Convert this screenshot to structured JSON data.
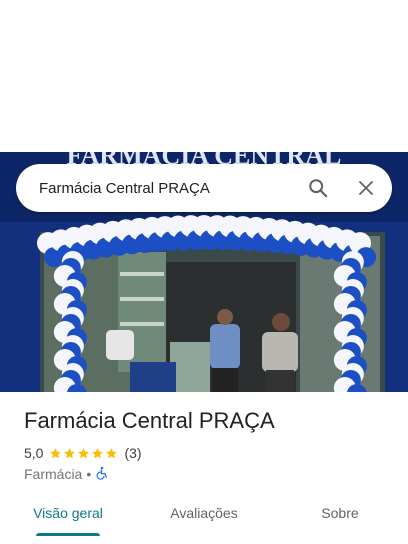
{
  "search": {
    "query": "Farmácia Central PRAÇA",
    "search_icon": "search-icon",
    "close_icon": "close-icon"
  },
  "hero": {
    "sign_text": "FARMÁCIA CENTRAL"
  },
  "place": {
    "name": "Farmácia Central PRAÇA",
    "rating": "5,0",
    "stars": 5,
    "review_count": "(3)",
    "category": "Farmácia",
    "separator": "•",
    "accessibility_icon": "wheelchair-icon"
  },
  "tabs": [
    {
      "label": "Visão geral",
      "active": true
    },
    {
      "label": "Avaliações",
      "active": false
    },
    {
      "label": "Sobre",
      "active": false
    }
  ],
  "colors": {
    "accent": "#0b7b8a",
    "star": "#fbbc04",
    "accessibility": "#1a73e8",
    "storefront": "#0e2a73"
  }
}
